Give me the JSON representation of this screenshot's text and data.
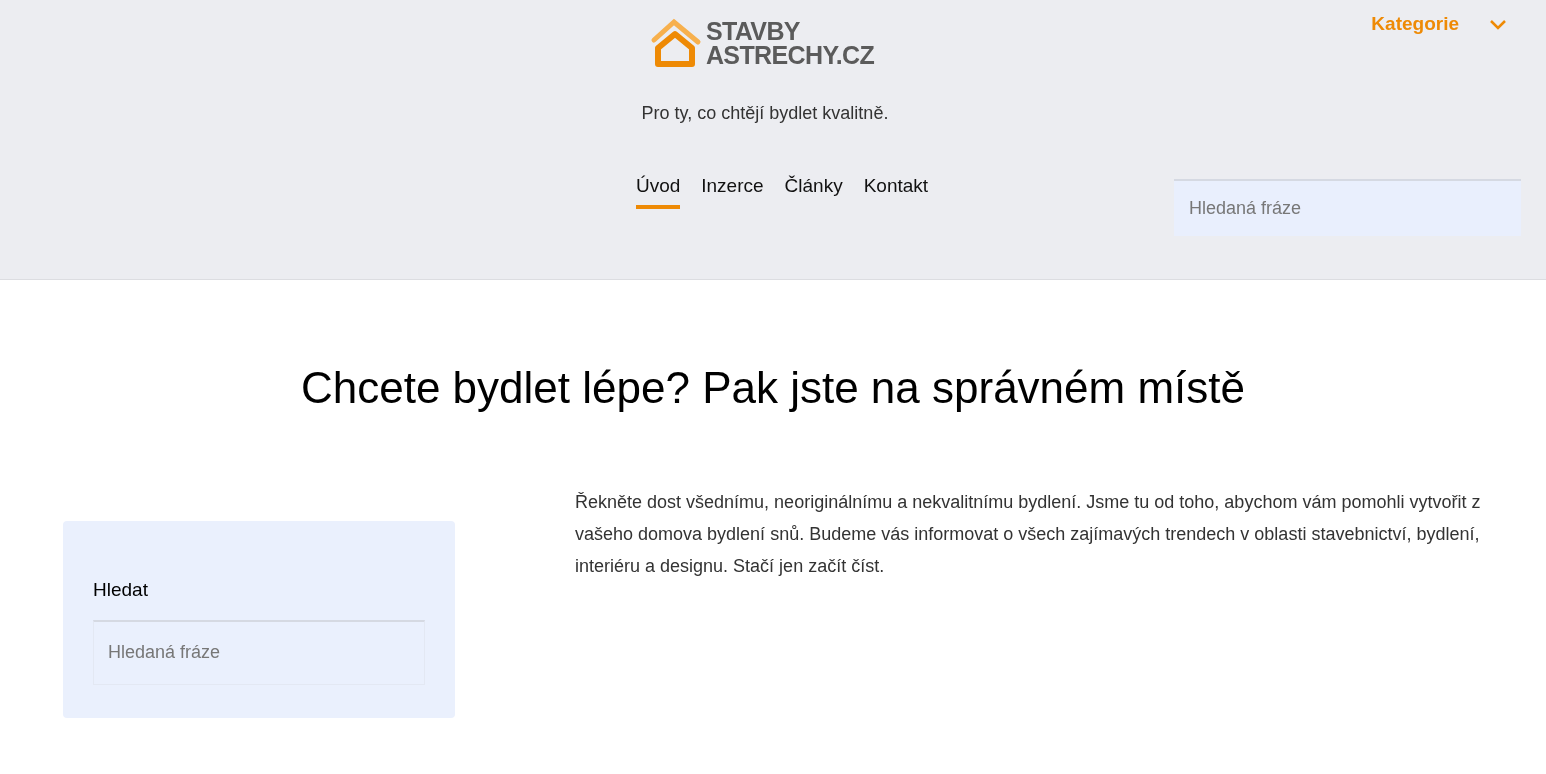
{
  "header": {
    "logo": {
      "line_1": "STAVBY",
      "line_2": "ASTRECHY.CZ"
    },
    "tagline": "Pro ty, co chtějí bydlet kvalitně.",
    "categories_menu": {
      "label": "Kategorie",
      "expanded": false
    },
    "nav": [
      {
        "label": "Úvod",
        "selected": true
      },
      {
        "label": "Inzerce",
        "selected": false
      },
      {
        "label": "Články",
        "selected": false
      },
      {
        "label": "Kontakt",
        "selected": false
      }
    ],
    "search": {
      "placeholder": "Hledaná fráze"
    }
  },
  "main": {
    "heading": "Chcete bydlet lépe? Pak jste na správném místě",
    "intro": "Řekněte dost všednímu, neoriginálnímu a nekvalitnímu bydlení. Jsme tu od toho, abychom vám pomohli vytvořit z vašeho domova bydlení snů. Budeme vás informovat o všech zajímavých trendech v oblasti stavebnictví, bydlení, interiéru a designu. Stačí jen začít číst."
  },
  "sidebar": {
    "title": "Hledat",
    "search": {
      "placeholder": "Hledaná fráze"
    }
  }
}
